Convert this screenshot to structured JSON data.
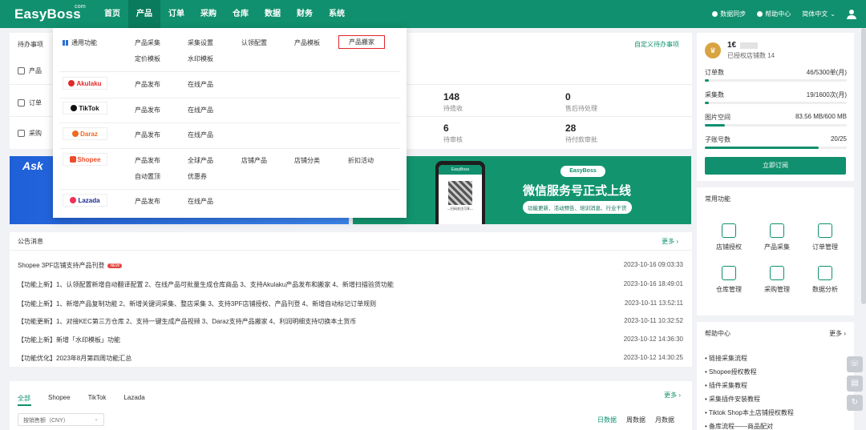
{
  "app": {
    "logo": "EasyBoss",
    "logo_com": "com"
  },
  "nav": [
    "首页",
    "产品",
    "订单",
    "采购",
    "仓库",
    "数据",
    "财务",
    "系统"
  ],
  "top_right": {
    "sync": "数据同步",
    "help": "帮助中心",
    "lang": "简体中文"
  },
  "todo": {
    "title": "待办事项",
    "custom": "自定义待办事项",
    "rows": [
      "产品",
      "订单",
      "采购"
    ],
    "stats": [
      {
        "n": "148",
        "l": "待揽收"
      },
      {
        "n": "0",
        "l": "售后待处理"
      },
      {
        "n": "6",
        "l": "待审核"
      },
      {
        "n": "28",
        "l": "待付款审批"
      }
    ]
  },
  "dropdown": {
    "general": {
      "label": "通用功能",
      "links": [
        "产品采集",
        "采集设置",
        "认领配置",
        "产品模板",
        "产品搬家",
        "定价模板",
        "水印模板"
      ],
      "highlight": "产品搬家"
    },
    "akulaku": {
      "name": "Akulaku",
      "links": [
        "产品发布",
        "在线产品"
      ]
    },
    "tiktok": {
      "name": "TikTok",
      "links": [
        "产品发布",
        "在线产品"
      ]
    },
    "daraz": {
      "name": "Daraz",
      "links": [
        "产品发布",
        "在线产品"
      ]
    },
    "shopee": {
      "name": "Shopee",
      "links": [
        "产品发布",
        "全球产品",
        "店铺产品",
        "店铺分类",
        "折扣活动",
        "自动置顶",
        "优惠券"
      ]
    },
    "lazada": {
      "name": "Lazada",
      "links": [
        "产品发布",
        "在线产品"
      ]
    }
  },
  "banner_left": {
    "title": "Ask"
  },
  "banner_right": {
    "badge": "EasyBoss",
    "title": "微信服务号正式上线",
    "subtitle": "功能更新、活动预告、培训消息、行业干货",
    "phone_head": "EasyBoss",
    "phone_caption": "—扫码关注可享—"
  },
  "notice": {
    "title": "公告消息",
    "more": "更多 ›",
    "items": [
      {
        "text": "Shopee 3PF店铺支持产品刊登",
        "badge": "NEW",
        "date": "2023-10-16 09:03:33"
      },
      {
        "text": "【功能上新】1、认领配置新增自动翻译配置 2、在线产品可批量生成仓库商品 3、支持Akulaku产品发布和搬家 4、新增扫描验货功能",
        "date": "2023-10-16 18:49:01"
      },
      {
        "text": "【功能上新】1、新增产品复制功能 2、新增关键词采集、整店采集 3、支持3PF店铺授权、产品刊登 4、新增自动标记订单规则",
        "date": "2023-10-11 13:52:11"
      },
      {
        "text": "【功能更新】1、对接KEC第三方仓库 2、支持一键生成产品视频 3、Daraz支持产品搬家 4、利润明细支持切换本土货币",
        "date": "2023-10-11 10:32:52"
      },
      {
        "text": "【功能上新】新增「水印模板」功能",
        "date": "2023-10-12 14:36:30"
      },
      {
        "text": "【功能优化】2023年8月第四周功能汇总",
        "date": "2023-10-12 14:30:25"
      }
    ]
  },
  "bottom": {
    "tabs": [
      "全部",
      "Shopee",
      "TikTok",
      "Lazada"
    ],
    "more": "更多 ›",
    "select": "按销售额（CNY）",
    "ranges": [
      "日数据",
      "周数据",
      "月数据"
    ]
  },
  "account": {
    "name": "1€",
    "sub": "已授权店铺数 14",
    "metrics": [
      {
        "label": "订单数",
        "value": "46/5300单(月)",
        "fill": 0.01
      },
      {
        "label": "采集数",
        "value": "19/1600次(月)",
        "fill": 0.01
      },
      {
        "label": "图片空间",
        "value": "83.56 MB/600 MB",
        "fill": 0.14
      },
      {
        "label": "子账号数",
        "value": "20/25",
        "fill": 0.8
      }
    ],
    "subscribe": "立即订阅"
  },
  "common_funcs": {
    "title": "常用功能",
    "items": [
      "店铺授权",
      "产品采集",
      "订单管理",
      "仓库管理",
      "采购管理",
      "数据分析"
    ]
  },
  "help": {
    "title": "帮助中心",
    "more": "更多 ›",
    "items": [
      "链接采集流程",
      "Shopee授权教程",
      "插件采集教程",
      "采集插件安装教程",
      "Tiktok Shop本土店铺授权教程",
      "备库流程——商品配对"
    ]
  },
  "colors": {
    "brand": "#10906e",
    "highlight": "#e1252b"
  }
}
